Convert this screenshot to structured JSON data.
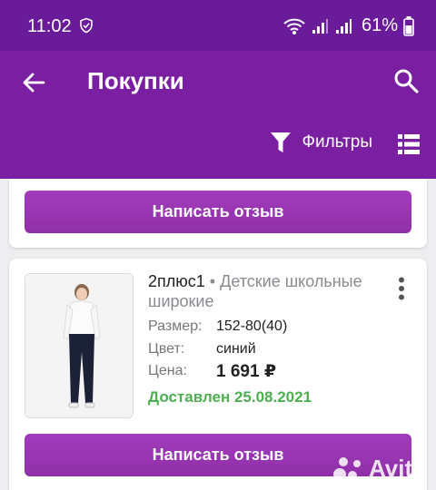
{
  "status_bar": {
    "time": "11:02",
    "battery": "61%"
  },
  "app_bar": {
    "title": "Покупки",
    "filters_label": "Фильтры"
  },
  "order_top": {
    "review_button": "Написать отзыв"
  },
  "order": {
    "brand": "2плюс1",
    "separator": "•",
    "product": "Детские школьные широкие",
    "size_label": "Размер:",
    "size_value": "152-80(40)",
    "color_label": "Цвет:",
    "color_value": "синий",
    "price_label": "Цена:",
    "price_value": "1 691 ₽",
    "status": "Доставлен 25.08.2021",
    "review_button": "Написать отзыв"
  },
  "watermark": {
    "text": "Avito"
  },
  "colors": {
    "status_bar": "#6a1b9a",
    "app_bar": "#7b1fa2",
    "button": "#9c27b0",
    "delivered": "#4caf50"
  },
  "icons": [
    "shield-icon",
    "wifi-icon",
    "signal-icon",
    "battery-icon",
    "back-arrow-icon",
    "search-icon",
    "filter-icon",
    "list-view-icon",
    "more-vert-icon"
  ]
}
